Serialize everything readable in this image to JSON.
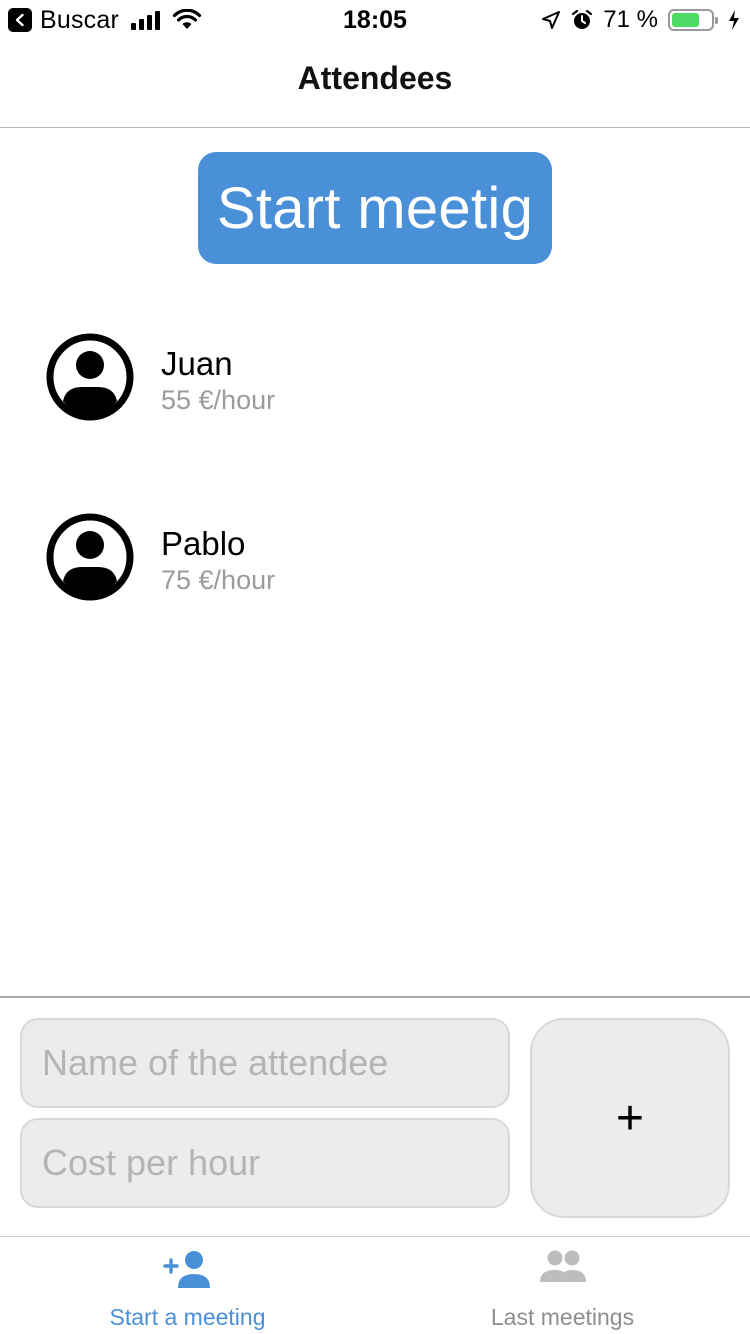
{
  "status_bar": {
    "back_label": "Buscar",
    "time": "18:05",
    "battery_percent": "71 %",
    "battery_level": 0.71
  },
  "header": {
    "title": "Attendees"
  },
  "start_button": {
    "label": "Start meetig"
  },
  "attendees": [
    {
      "name": "Juan",
      "rate": "55 €/hour"
    },
    {
      "name": "Pablo",
      "rate": "75 €/hour"
    }
  ],
  "form": {
    "name_placeholder": "Name of the attendee",
    "cost_placeholder": "Cost per hour",
    "add_label": "+"
  },
  "tabs": [
    {
      "label": "Start a meeting",
      "icon": "add-person-icon",
      "active": true
    },
    {
      "label": "Last meetings",
      "icon": "people-icon",
      "active": false
    }
  ],
  "colors": {
    "accent": "#4a90d9",
    "inactive": "#9b9b9b",
    "battery": "#4cd964"
  }
}
